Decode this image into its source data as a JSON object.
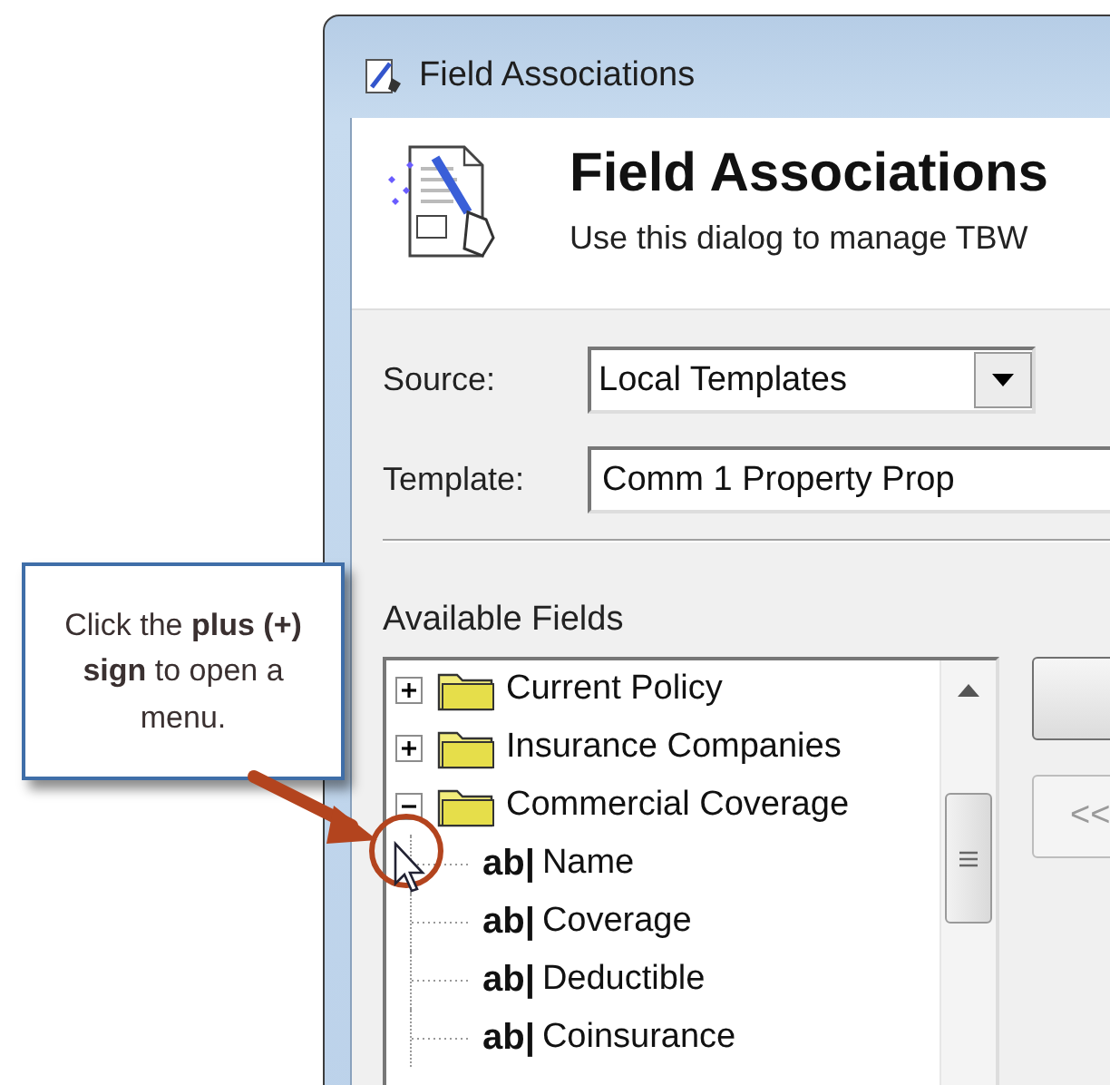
{
  "window": {
    "title": "Field Associations"
  },
  "header": {
    "heading": "Field Associations",
    "subtitle": "Use this dialog to manage TBW"
  },
  "form": {
    "source": {
      "label": "Source:",
      "value": "Local Templates"
    },
    "template": {
      "label": "Template:",
      "value": "Comm 1 Property Prop"
    }
  },
  "available_fields": {
    "label": "Available Fields",
    "tree": [
      {
        "kind": "folder",
        "label": "Current Policy",
        "expanded": false
      },
      {
        "kind": "folder",
        "label": "Insurance Companies",
        "expanded": false
      },
      {
        "kind": "folder",
        "label": "Commercial Coverage",
        "expanded": true,
        "children": [
          {
            "kind": "field",
            "badge": "ab|",
            "label": "Name"
          },
          {
            "kind": "field",
            "badge": "ab|",
            "label": "Coverage"
          },
          {
            "kind": "field",
            "badge": "ab|",
            "label": "Deductible"
          },
          {
            "kind": "field",
            "badge": "ab|",
            "label": "Coinsurance"
          }
        ]
      }
    ]
  },
  "buttons": [
    {
      "disabled": false
    },
    {
      "label": "<<",
      "disabled": true
    }
  ],
  "callout": {
    "text": "Click the **plus (+) sign** to open a menu."
  }
}
